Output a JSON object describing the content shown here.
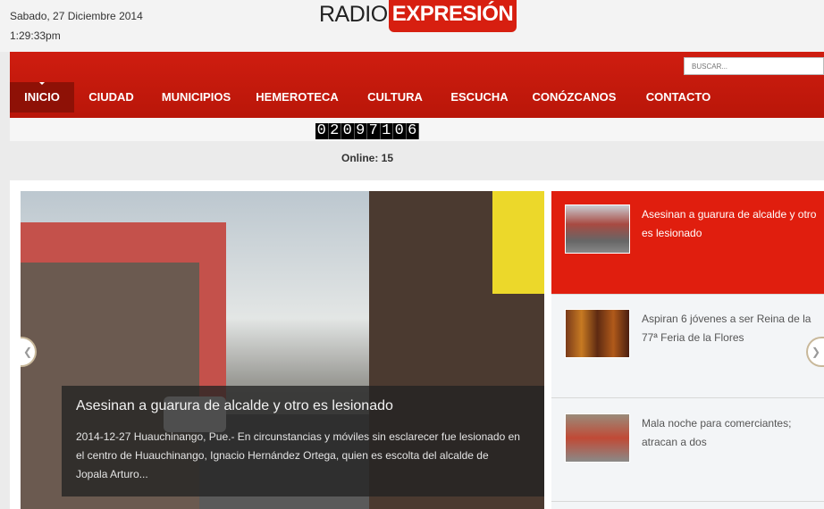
{
  "header": {
    "date": "Sabado, 27  Diciembre 2014",
    "time": "1:29:33pm",
    "logo_left": "RADIO",
    "logo_right": "EXPRESIÓN"
  },
  "search": {
    "placeholder": "BUSCAR..."
  },
  "nav": {
    "items": [
      {
        "label": "INICIO",
        "active": true
      },
      {
        "label": "CIUDAD"
      },
      {
        "label": "MUNICIPIOS"
      },
      {
        "label": "HEMEROTECA"
      },
      {
        "label": "CULTURA"
      },
      {
        "label": "ESCUCHA"
      },
      {
        "label": "CONÓZCANOS"
      },
      {
        "label": "CONTACTO"
      }
    ]
  },
  "counter": {
    "digits": [
      "0",
      "2",
      "0",
      "9",
      "7",
      "1",
      "0",
      "6"
    ],
    "online": "Online: 15"
  },
  "slider": {
    "title": "Asesinan a guarura de alcalde y otro es lesionado",
    "text": "2014-12-27 Huauchinango, Pue.- En circunstancias y móviles sin esclarecer fue lesionado en el centro de Huauchinango, Ignacio Hernández Ortega, quien es escolta del alcalde de Jopala Arturo..."
  },
  "side_items": [
    {
      "title": "Asesinan a guarura de alcalde y otro es lesionado",
      "active": true
    },
    {
      "title": "Aspiran 6 jóvenes a ser Reina de la 77ª Feria de la Flores"
    },
    {
      "title": "Mala noche para comerciantes; atracan a dos"
    }
  ],
  "colors": {
    "brand_red": "#d71f10",
    "nav_active": "#8e1106"
  }
}
